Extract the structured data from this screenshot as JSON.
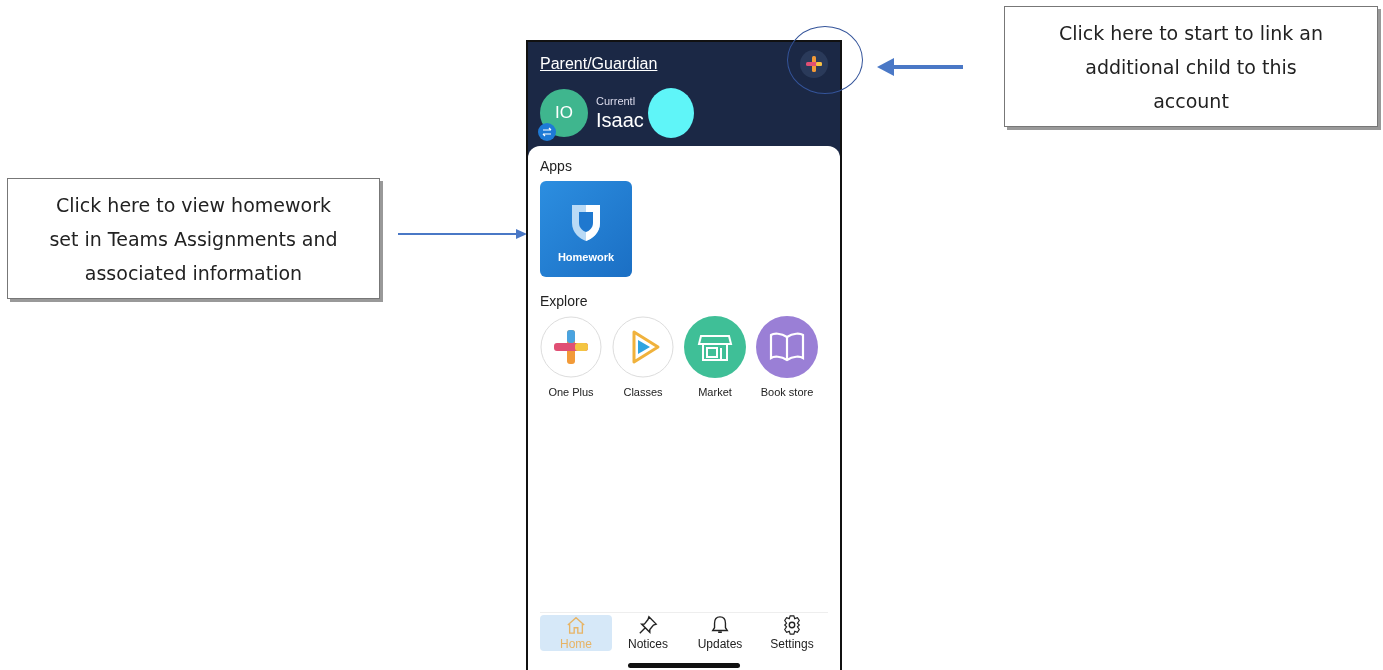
{
  "header": {
    "title": "Parent/Guardian",
    "avatar_initials": "IO",
    "caption": "Currentl",
    "child_name": "Isaac"
  },
  "apps": {
    "heading": "Apps",
    "items": [
      {
        "label": "Homework"
      }
    ]
  },
  "explore": {
    "heading": "Explore",
    "items": [
      {
        "label": "One Plus",
        "kind": "plus"
      },
      {
        "label": "Classes",
        "kind": "play"
      },
      {
        "label": "Market",
        "kind": "store"
      },
      {
        "label": "Book store",
        "kind": "book"
      }
    ]
  },
  "nav": [
    {
      "label": "Home",
      "kind": "home",
      "selected": true
    },
    {
      "label": "Notices",
      "kind": "pin",
      "selected": false
    },
    {
      "label": "Updates",
      "kind": "bell",
      "selected": false
    },
    {
      "label": "Settings",
      "kind": "gear",
      "selected": false
    }
  ],
  "callouts": [
    {
      "kind": "left",
      "text": "Click here to view homework set in Teams Assignments and associated information"
    },
    {
      "kind": "right",
      "text": "Click here to start to link an additional child to this account"
    }
  ]
}
